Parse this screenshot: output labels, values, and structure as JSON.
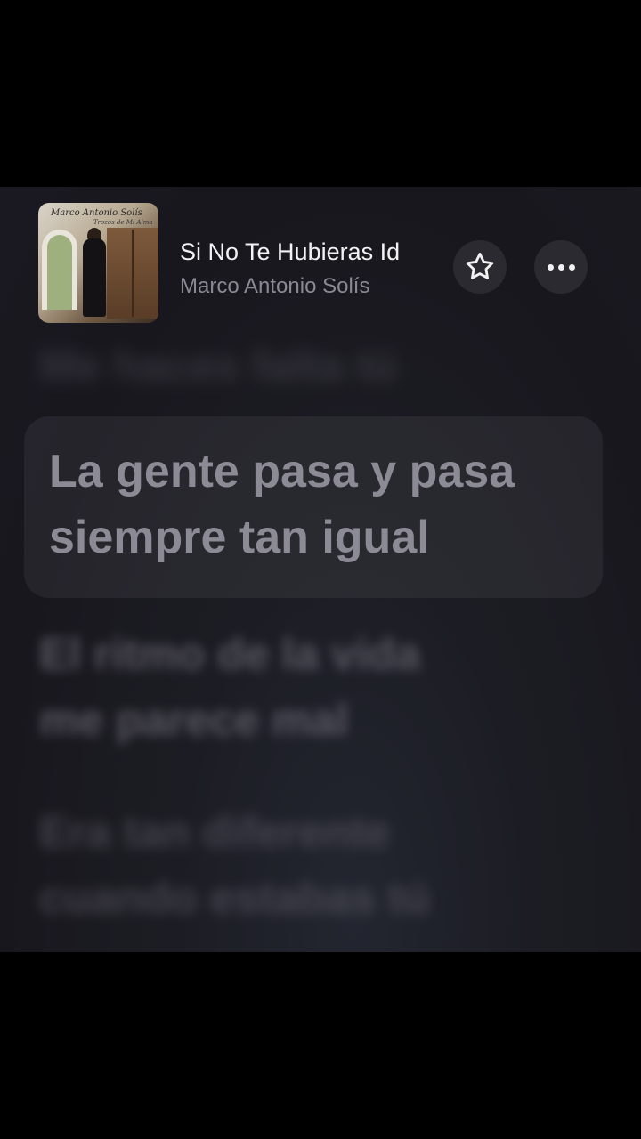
{
  "now_playing": {
    "title": "Si No Te Hubieras Id",
    "artist": "Marco Antonio Solís",
    "album_art_text": "Marco Antonio Solís",
    "album_art_subtext": "Trozos de Mi Alma"
  },
  "controls": {
    "favorite_icon": "star-icon",
    "more_icon": "ellipsis-icon"
  },
  "lyrics": {
    "previous": [
      "Me haces falta tú"
    ],
    "current": [
      "La gente pasa y pasa",
      "siempre tan igual"
    ],
    "next": [
      "El ritmo de la vida",
      "me parece mal"
    ],
    "upcoming": [
      "Era tan diferente",
      "cuando estabas tú"
    ]
  },
  "colors": {
    "background": "#1a1820",
    "highlight_box": "#2a2930",
    "active_lyric": "#8c8a94",
    "inactive_lyric": "#6b6973"
  }
}
